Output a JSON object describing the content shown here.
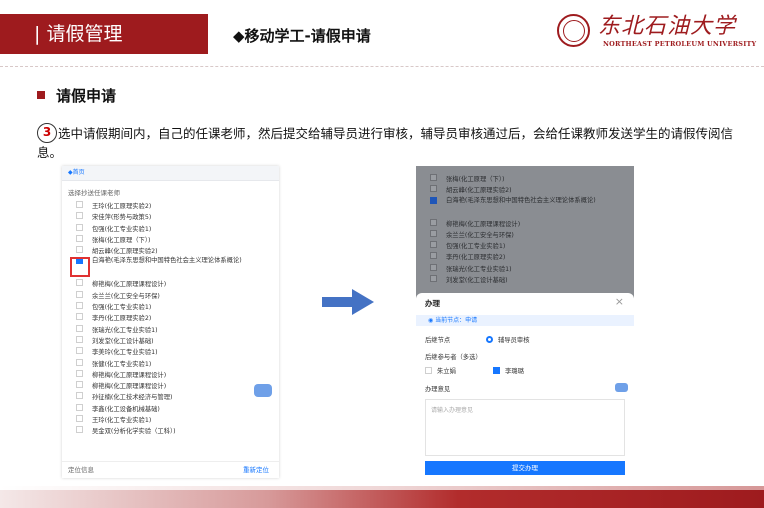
{
  "header": {
    "title": "| 请假管理",
    "subtitle": "◆移动学工-请假申请",
    "logo_cn": "东北石油大学",
    "logo_en": "NORTHEAST PETROLEUM UNIVERSITY"
  },
  "section": {
    "title": "请假申请",
    "step_number": "3",
    "instruction": "选中请假期间内，自己的任课老师，然后提交给辅导员进行审核，辅导员审核通过后，会给任课教师发送学生的请假传阅信息。"
  },
  "left_phone": {
    "top_bar": "◆首页",
    "caption": "选择抄送任课老师",
    "teachers": [
      {
        "name": "王玲(化工原理实验2)",
        "checked": false
      },
      {
        "name": "宋佳萍(形势与政策5)",
        "checked": false
      },
      {
        "name": "包强(化工专业实验1)",
        "checked": false
      },
      {
        "name": "张梅(化工原理（下）)",
        "checked": false
      },
      {
        "name": "胡云峰(化工原理实验2)",
        "checked": false
      },
      {
        "name": "白海艳(毛泽东思想和中国特色社会主义理论体系概论)",
        "checked": true
      },
      {
        "name": "柳艳梅(化工原理课程设计)",
        "checked": false
      },
      {
        "name": "余兰兰(化工安全与环保)",
        "checked": false
      },
      {
        "name": "包强(化工专业实验1)",
        "checked": false
      },
      {
        "name": "李丹(化工原理实验2)",
        "checked": false
      },
      {
        "name": "张瑞光(化工专业实验1)",
        "checked": false
      },
      {
        "name": "刘发堂(化工设计基础)",
        "checked": false
      },
      {
        "name": "李美玲(化工专业实验1)",
        "checked": false
      },
      {
        "name": "张健(化工专业实验1)",
        "checked": false
      },
      {
        "name": "柳艳梅(化工原理课程设计)",
        "checked": false
      },
      {
        "name": "柳艳梅(化工原理课程设计)",
        "checked": false
      },
      {
        "name": "孙征楠(化工技术经济与管理)",
        "checked": false
      },
      {
        "name": "李鑫(化工设备机械基础)",
        "checked": false
      },
      {
        "name": "王玲(化工专业实验1)",
        "checked": false
      },
      {
        "name": "吴金双(分析化学实验（工科）)",
        "checked": false
      }
    ],
    "footer_label": "定位信息",
    "footer_link": "重新定位"
  },
  "right_phone": {
    "teachers": [
      {
        "name": "张梅(化工原理（下）)",
        "checked": false
      },
      {
        "name": "胡云峰(化工原理实验2)",
        "checked": false
      },
      {
        "name": "白海艳(毛泽东思想和中国特色社会主义理论体系概论)",
        "checked": true
      },
      {
        "name": "柳艳梅(化工原理课程设计)",
        "checked": false
      },
      {
        "name": "余兰兰(化工安全与环保)",
        "checked": false
      },
      {
        "name": "包强(化工专业实验1)",
        "checked": false
      },
      {
        "name": "李丹(化工原理实验2)",
        "checked": false
      },
      {
        "name": "张瑞光(化工专业实验1)",
        "checked": false
      },
      {
        "name": "刘发堂(化工设计基础)",
        "checked": false
      }
    ],
    "panel": {
      "title": "办理",
      "close": "×",
      "current_node": "◉ 当前节点：申请",
      "next_node_label": "后继节点",
      "next_node_value": "辅导员审核",
      "participants_label": "后继参与者（多选）",
      "participant_1": "朱立娟",
      "participant_2": "李璐璐",
      "opinion_label": "办理意见",
      "opinion_placeholder": "请输入办理意见",
      "submit": "提交办理"
    }
  },
  "colors": {
    "brand": "#9e1b1e",
    "accent": "#1677ff",
    "highlight": "#e03131"
  }
}
